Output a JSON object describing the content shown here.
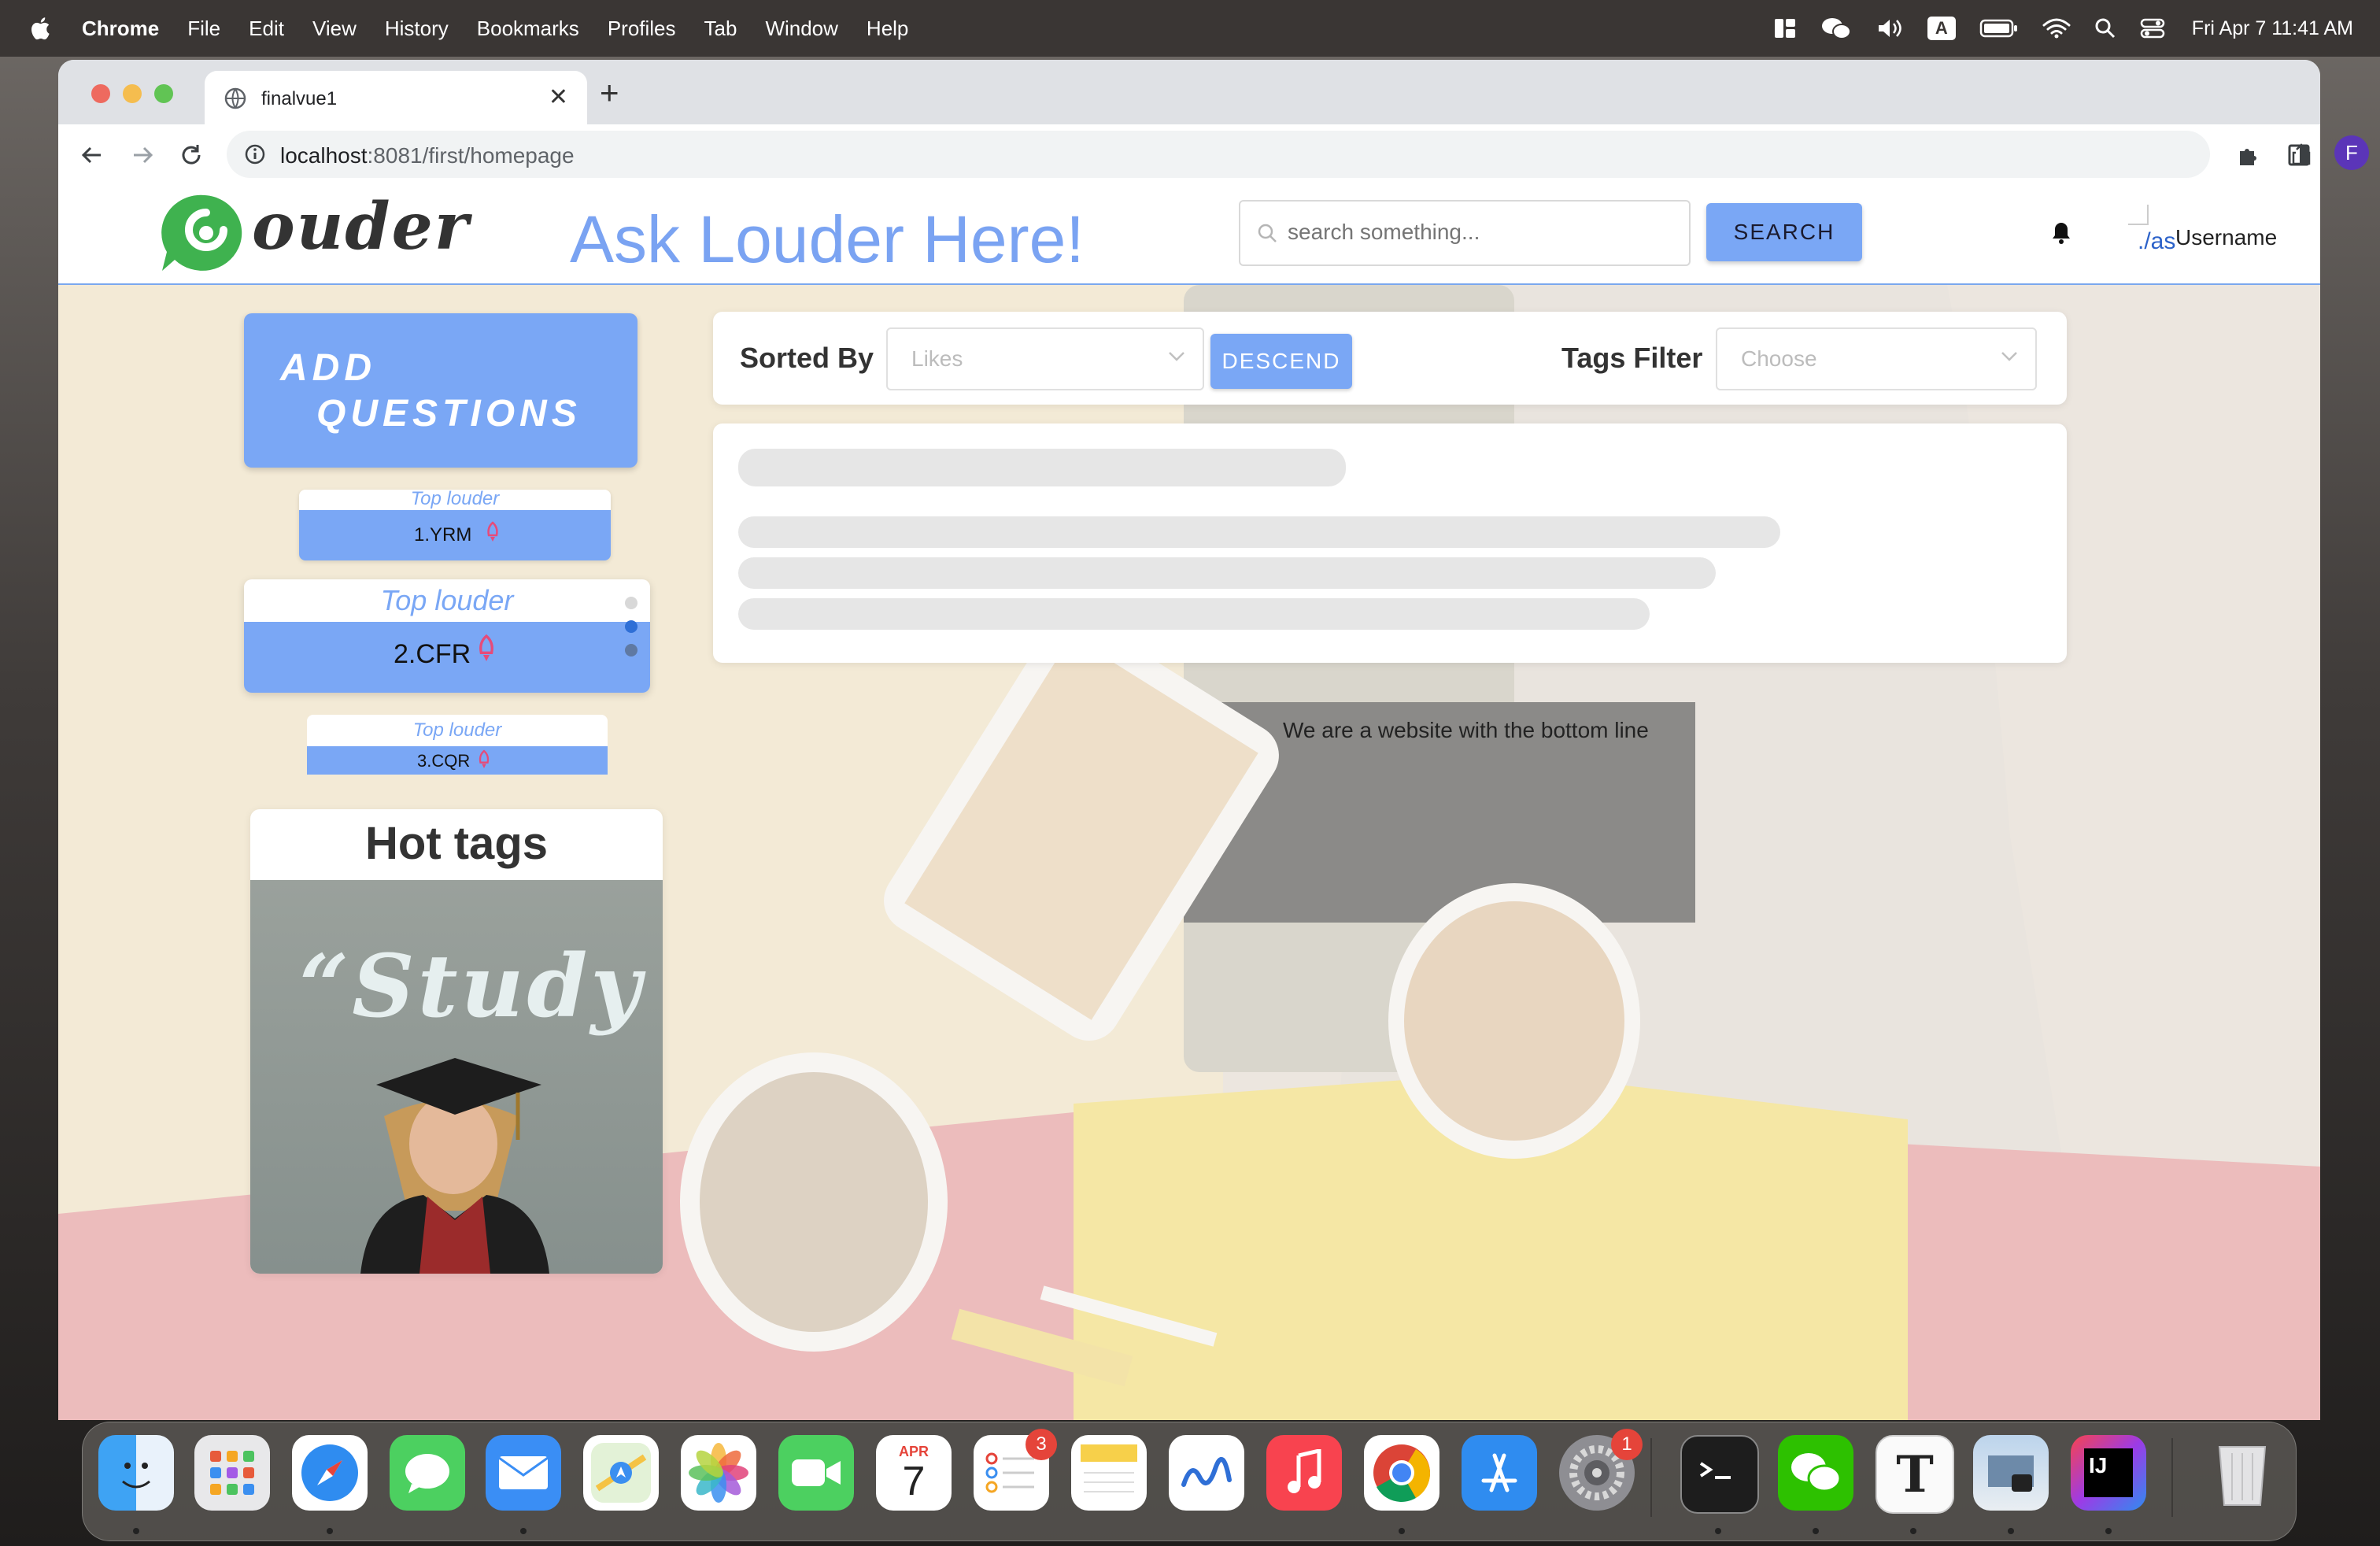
{
  "menubar": {
    "app": "Chrome",
    "items": [
      "File",
      "Edit",
      "View",
      "History",
      "Bookmarks",
      "Profiles",
      "Tab",
      "Window",
      "Help"
    ],
    "input_indicator": "A",
    "clock": "Fri Apr 7  11:41 AM"
  },
  "browser": {
    "tab_title": "finalvue1",
    "url_host": "localhost",
    "url_path": ":8081/first/homepage",
    "profile_initial": "F"
  },
  "header": {
    "logo_text": "ouder",
    "headline": "Ask Louder Here!",
    "search_placeholder": "search something...",
    "search_button": "SEARCH",
    "avatar_alt": "./as",
    "username": "Username"
  },
  "sidebar": {
    "add_questions_line1": "ADD",
    "add_questions_line2": "QUESTIONS",
    "carousel": [
      {
        "caption": "Top louder",
        "name": "1.YRM"
      },
      {
        "caption": "Top louder",
        "name": "2.CFR"
      },
      {
        "caption": "Top louder",
        "name": "3.CQR"
      }
    ],
    "hot_tags_title": "Hot tags",
    "hot_tags_image_text": "“Study"
  },
  "filters": {
    "sorted_by_label": "Sorted By",
    "sorted_by_value": "Likes",
    "order_button": "DESCEND",
    "tags_label": "Tags Filter",
    "tags_placeholder": "Choose"
  },
  "footer_text": "We are a website with the bottom line",
  "dock": {
    "reminders_badge": "3",
    "settings_badge": "1",
    "calendar_month": "APR",
    "calendar_day": "7"
  },
  "colors": {
    "accent_blue": "#7aa7f5",
    "logo_green": "#3fb24f",
    "headline_blue": "#7aa3f2"
  }
}
